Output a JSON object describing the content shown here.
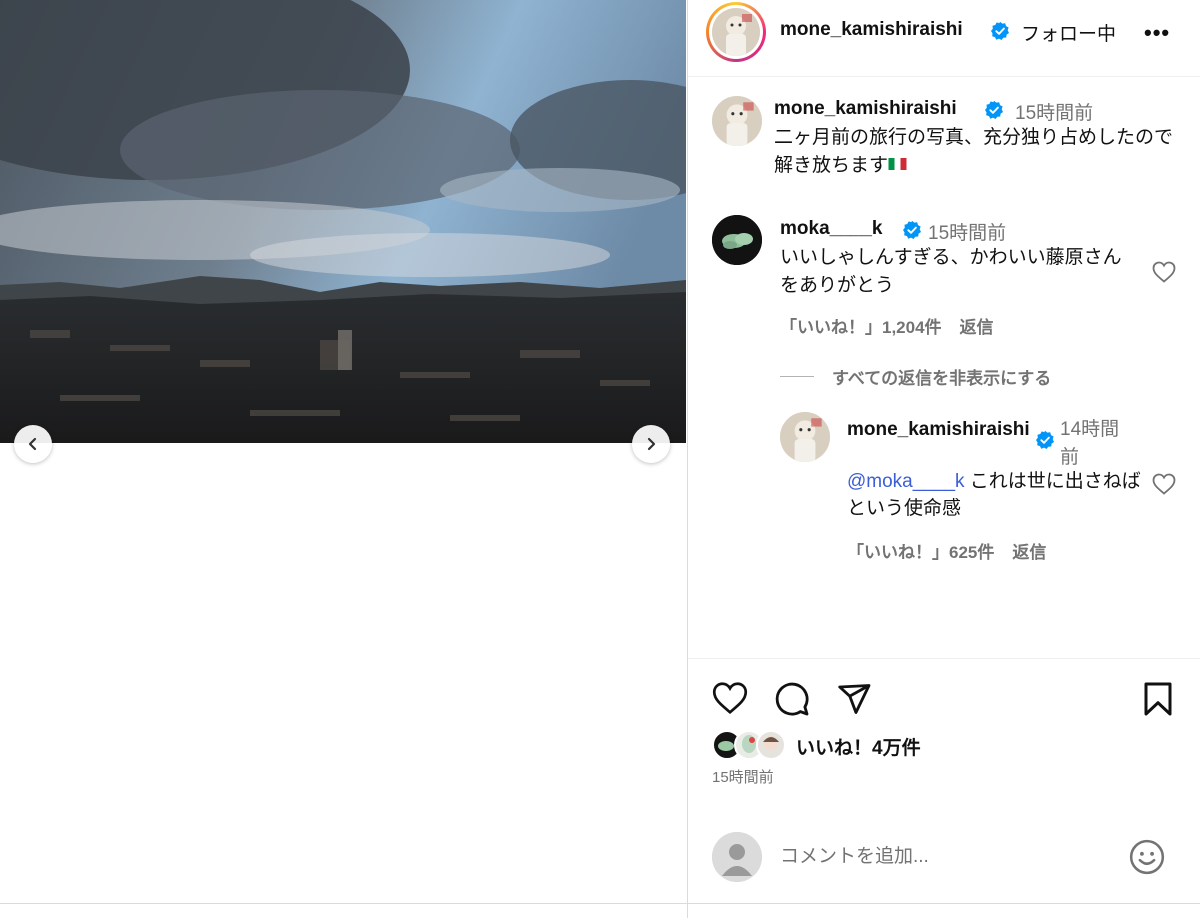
{
  "post": {
    "author": "mone_kamishiraishi",
    "follow_status": "フォロー中",
    "more_label": "•••",
    "caption": {
      "username": "mone_kamishiraishi",
      "time": "15時間前",
      "text": "二ヶ月前の旅行の写真、充分独り占めしたので解き放ちます"
    },
    "likes": "いいね！4万件",
    "time": "15時間前"
  },
  "comments": [
    {
      "username": "moka____k",
      "time": "15時間前",
      "text": "いいしゃしんすぎる、かわいい藤原さんをありがとう",
      "likes": "「いいね！」1,204件",
      "reply_label": "返信",
      "hide_replies": "すべての返信を非表示にする",
      "replies": [
        {
          "username": "mone_kamishiraishi",
          "time": "14時間前",
          "mention": "@moka____k",
          "text": " これは世に出さねばという使命感",
          "likes": "「いいね！」625件",
          "reply_label": "返信"
        }
      ]
    }
  ],
  "composer": {
    "placeholder": "コメントを追加..."
  },
  "icons": {
    "prev": "chevron-left-icon",
    "next": "chevron-right-icon",
    "verified": "verified-badge-icon",
    "heart": "heart-icon",
    "comment": "comment-icon",
    "share": "paper-plane-icon",
    "save": "bookmark-icon",
    "emoji": "smiley-icon",
    "flag": "italy-flag-icon"
  },
  "colors": {
    "verified": "#0095f6",
    "muted": "#737373",
    "mention": "#3b5ed8",
    "divider": "#dbdbdb"
  }
}
